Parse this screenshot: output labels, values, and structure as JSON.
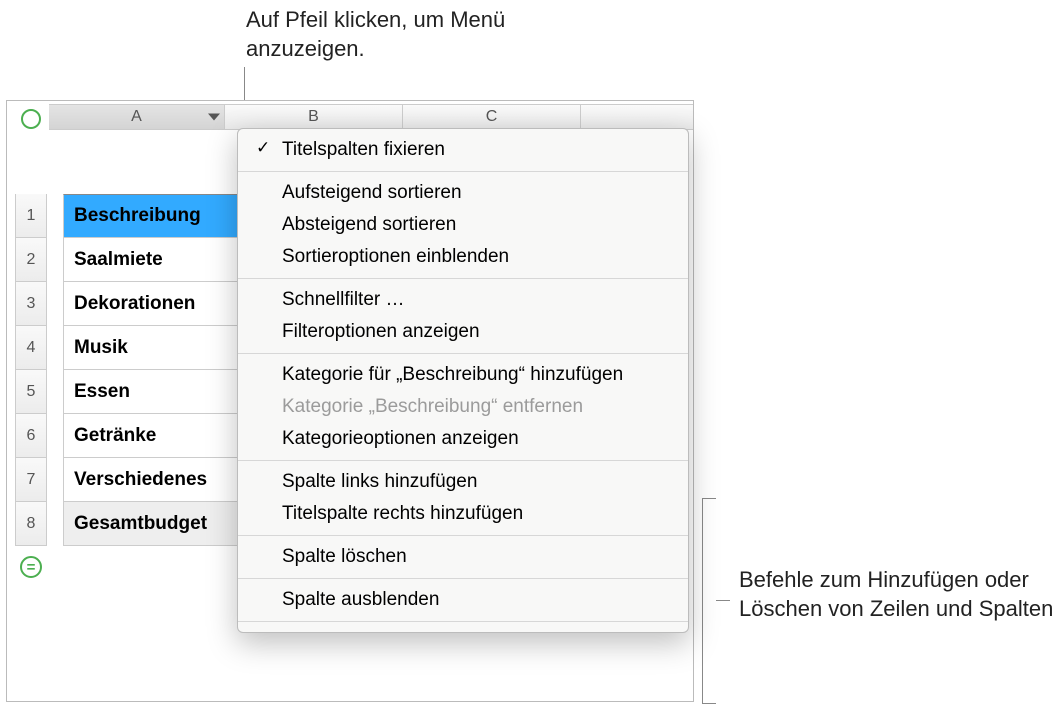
{
  "annotations": {
    "top": "Auf Pfeil klicken, um Menü anzuzeigen.",
    "right": "Befehle zum Hinzufügen oder Löschen von Zeilen und Spalten"
  },
  "columns": [
    "A",
    "B",
    "C"
  ],
  "selected_column": "A",
  "row_numbers": [
    "1",
    "2",
    "3",
    "4",
    "5",
    "6",
    "7",
    "8"
  ],
  "add_row_symbol": "=",
  "rows": [
    {
      "label": "Beschreibung",
      "type": "header"
    },
    {
      "label": "Saalmiete",
      "type": "bold"
    },
    {
      "label": "Dekorationen",
      "type": "bold"
    },
    {
      "label": "Musik",
      "type": "bold"
    },
    {
      "label": "Essen",
      "type": "bold"
    },
    {
      "label": "Getränke",
      "type": "bold"
    },
    {
      "label": "Verschiedenes",
      "type": "bold"
    },
    {
      "label": "Gesamtbudget",
      "type": "footer"
    }
  ],
  "menu": {
    "groups": [
      [
        {
          "label": "Titelspalten fixieren",
          "checked": true
        }
      ],
      [
        {
          "label": "Aufsteigend sortieren"
        },
        {
          "label": "Absteigend sortieren"
        },
        {
          "label": "Sortieroptionen einblenden"
        }
      ],
      [
        {
          "label": "Schnellfilter …"
        },
        {
          "label": "Filteroptionen anzeigen"
        }
      ],
      [
        {
          "label": "Kategorie für „Beschreibung“ hinzufügen"
        },
        {
          "label": "Kategorie „Beschreibung“ entfernen",
          "disabled": true
        },
        {
          "label": "Kategorieoptionen anzeigen"
        }
      ],
      [
        {
          "label": "Spalte links hinzufügen"
        },
        {
          "label": "Titelspalte rechts hinzufügen"
        }
      ],
      [
        {
          "label": "Spalte löschen"
        }
      ],
      [
        {
          "label": "Spalte ausblenden"
        }
      ]
    ]
  }
}
